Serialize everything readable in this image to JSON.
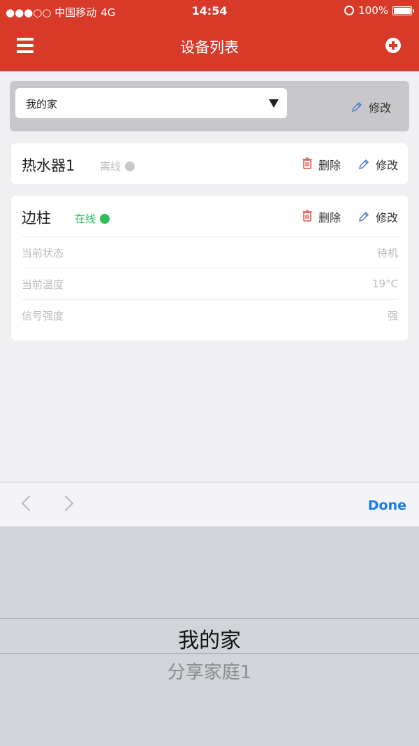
{
  "status_bar": {
    "carrier": "●●●○○ 中国移动",
    "network": "4G",
    "time": "14:54",
    "battery": "100%"
  },
  "nav": {
    "title": "设备列表",
    "menu_icon": "menu-icon",
    "add_icon": "add-circle-icon"
  },
  "home_selector": {
    "selected": "我的家",
    "edit_label": "修改"
  },
  "devices": [
    {
      "name": "热水器1",
      "status": "离线",
      "status_color": "#c8c8c8",
      "delete_label": "删除",
      "edit_label": "修改"
    },
    {
      "name": "边柱",
      "status": "在线",
      "status_color": "#2dbf5c",
      "delete_label": "删除",
      "edit_label": "修改",
      "details": [
        {
          "label": "当前状态",
          "value": "待机"
        },
        {
          "label": "当前温度",
          "value": "19°C"
        },
        {
          "label": "信号强度",
          "value": "强"
        }
      ]
    }
  ],
  "keyboard_accessory": {
    "done_label": "Done"
  },
  "picker": {
    "options": [
      "我的家",
      "分享家庭1"
    ],
    "selected_index": 0
  },
  "colors": {
    "brand": "#d83a2a",
    "online": "#2dbf5c",
    "done": "#1a7ce6"
  }
}
